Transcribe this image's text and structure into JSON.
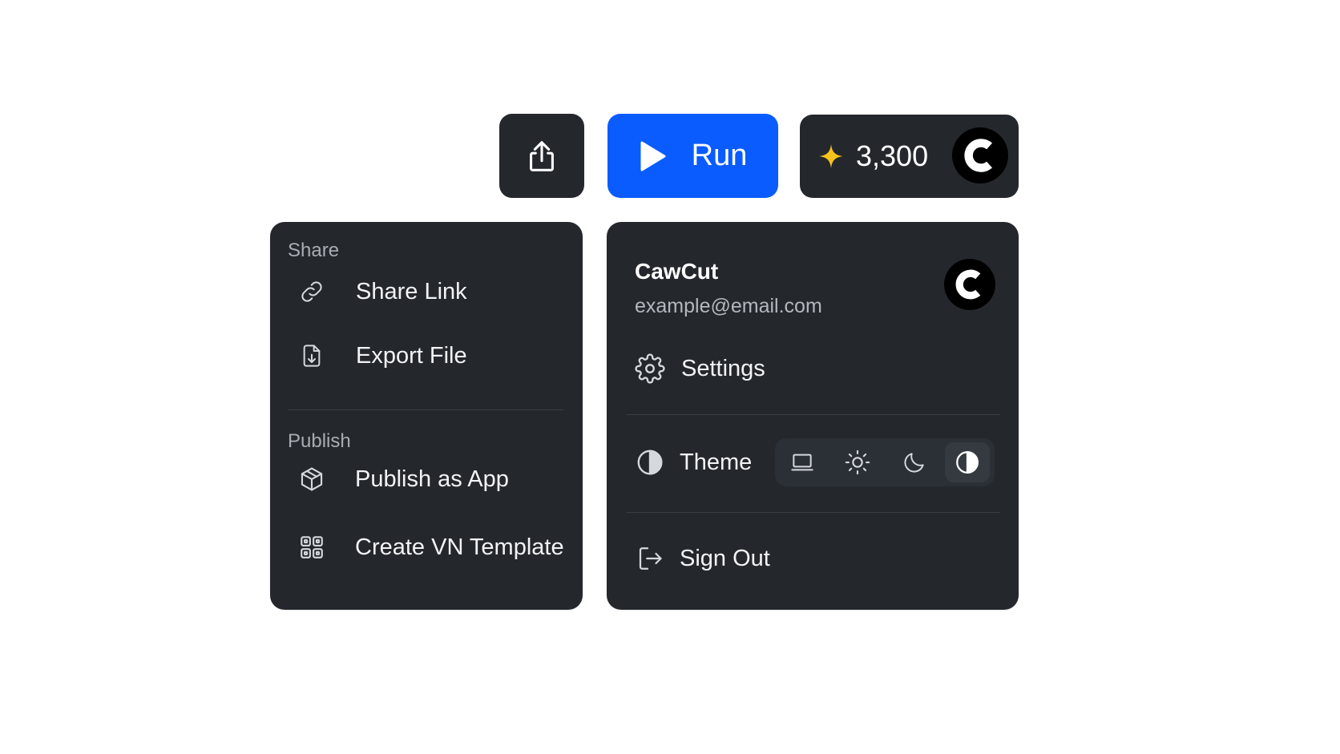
{
  "toolbar": {
    "share_icon": "share-upload-icon",
    "run_label": "Run",
    "run_color": "#0a5cff",
    "credits_count": "3,300",
    "credits_icon": "sparkle-star-icon",
    "star_color": "#f6c21c",
    "avatar_letter": "C"
  },
  "share_menu": {
    "share_section": "Share",
    "share_items": [
      {
        "label": "Share Link",
        "icon": "link-icon"
      },
      {
        "label": "Export File",
        "icon": "file-download-icon"
      }
    ],
    "publish_section": "Publish",
    "publish_items": [
      {
        "label": "Publish as App",
        "icon": "package-icon"
      },
      {
        "label": "Create VN Template",
        "icon": "template-grid-icon"
      }
    ]
  },
  "account_menu": {
    "user_name": "CawCut",
    "user_email": "example@email.com",
    "avatar_letter": "C",
    "settings_label": "Settings",
    "theme_label": "Theme",
    "theme_options": [
      {
        "icon": "laptop-icon",
        "active": false
      },
      {
        "icon": "sun-icon",
        "active": false
      },
      {
        "icon": "moon-icon",
        "active": false
      },
      {
        "icon": "contrast-icon",
        "active": true
      }
    ],
    "sign_out_label": "Sign Out"
  }
}
